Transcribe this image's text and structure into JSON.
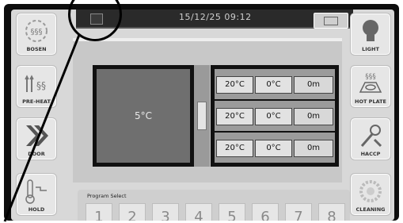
{
  "topbar": {
    "datetime": "15/12/25 09:12"
  },
  "left_menu": [
    {
      "label": "BOSEN"
    },
    {
      "label": "PRE-HEAT"
    },
    {
      "label": "DOOR"
    },
    {
      "label": "HOLD"
    }
  ],
  "right_menu": [
    {
      "label": "LIGHT"
    },
    {
      "label": "HOT PLATE"
    },
    {
      "label": "HACCP"
    },
    {
      "label": "CLEANING"
    }
  ],
  "chamber": {
    "temperature": "5°C"
  },
  "shelves": [
    {
      "set_temp": "20°C",
      "probe_temp": "0°C",
      "time": "0m"
    },
    {
      "set_temp": "20°C",
      "probe_temp": "0°C",
      "time": "0m"
    },
    {
      "set_temp": "20°C",
      "probe_temp": "0°C",
      "time": "0m"
    }
  ],
  "program": {
    "title": "Program Select",
    "numbers": [
      "1",
      "2",
      "3",
      "4",
      "5",
      "6",
      "7",
      "8"
    ]
  }
}
